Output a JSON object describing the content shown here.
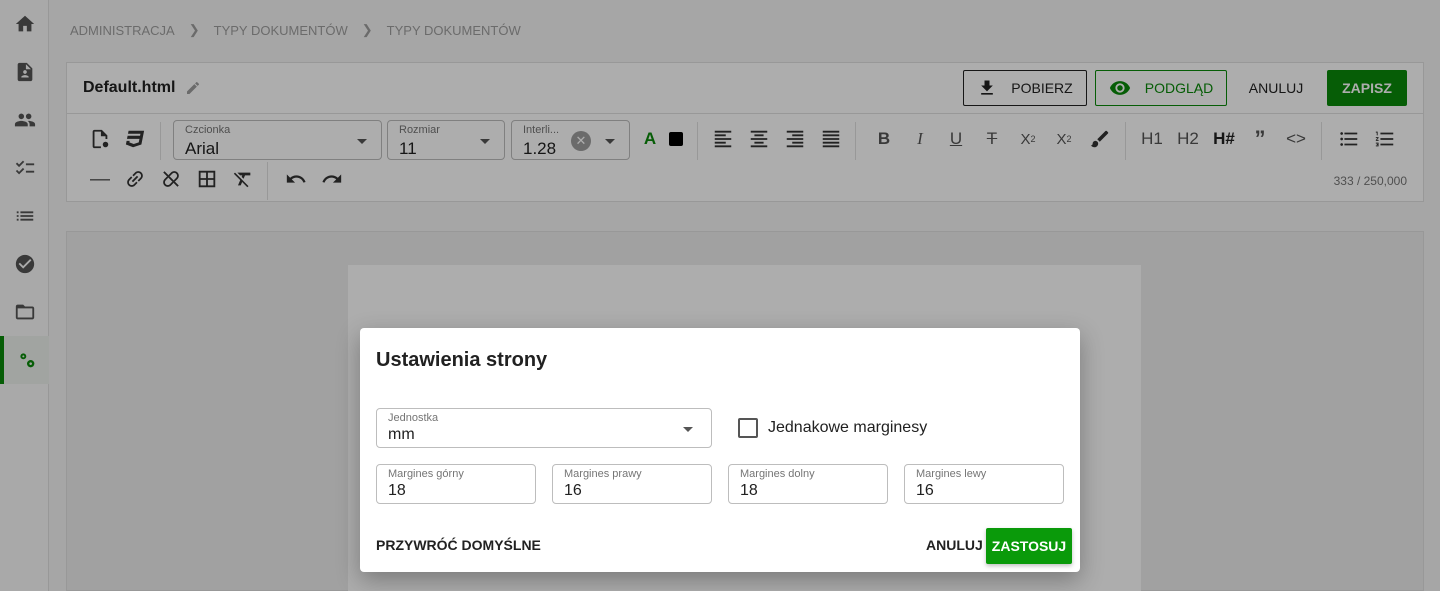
{
  "breadcrumb": [
    "ADMINISTRACJA",
    "TYPY DOKUMENTÓW",
    "TYPY DOKUMENTÓW"
  ],
  "sidebar": {
    "items": [
      {
        "icon": "home-icon"
      },
      {
        "icon": "document-user-icon"
      },
      {
        "icon": "people-icon"
      },
      {
        "icon": "checklist-icon"
      },
      {
        "icon": "list-icon"
      },
      {
        "icon": "check-circle-icon"
      },
      {
        "icon": "folder-open-icon"
      },
      {
        "icon": "settings-gears-icon",
        "active": true
      }
    ]
  },
  "editor": {
    "file_name": "Default.html",
    "download_label": "POBIERZ",
    "preview_label": "PODGLĄD",
    "cancel_label": "ANULUJ",
    "save_label": "ZAPISZ",
    "font_label": "Czcionka",
    "font_value": "Arial",
    "size_label": "Rozmiar",
    "size_value": "11",
    "line_label": "Interli...",
    "line_value": "1.28",
    "heading1": "H1",
    "heading2": "H2",
    "heading_custom": "H#",
    "char_count": "333 / 250,000"
  },
  "dialog": {
    "title": "Ustawienia strony",
    "unit_label": "Jednostka",
    "unit_value": "mm",
    "equal_margins_label": "Jednakowe marginesy",
    "margin_top_label": "Margines górny",
    "margin_top_value": "18",
    "margin_right_label": "Margines prawy",
    "margin_right_value": "16",
    "margin_bottom_label": "Margines dolny",
    "margin_bottom_value": "18",
    "margin_left_label": "Margines lewy",
    "margin_left_value": "16",
    "reset_label": "PRZYWRÓĆ DOMYŚLNE",
    "cancel_label": "ANULUJ",
    "apply_label": "ZASTOSUJ"
  },
  "colors": {
    "accent": "#0a8a0a",
    "overlay": "rgba(0,0,0,0.32)"
  }
}
